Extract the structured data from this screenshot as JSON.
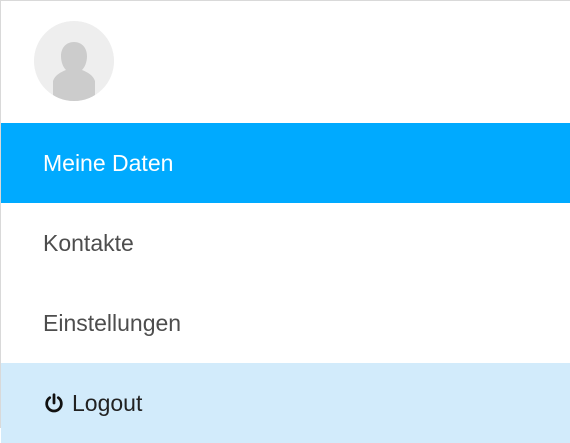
{
  "profile": {
    "avatar_icon": "user-avatar-icon"
  },
  "menu": {
    "items": [
      {
        "label": "Meine Daten",
        "active": true
      },
      {
        "label": "Kontakte",
        "active": false
      },
      {
        "label": "Einstellungen",
        "active": false
      }
    ],
    "logout": {
      "label": "Logout",
      "icon": "power-icon"
    }
  },
  "colors": {
    "active_background": "#00aaff",
    "logout_background": "#d2ebfb",
    "text": "#4d4d4d"
  }
}
